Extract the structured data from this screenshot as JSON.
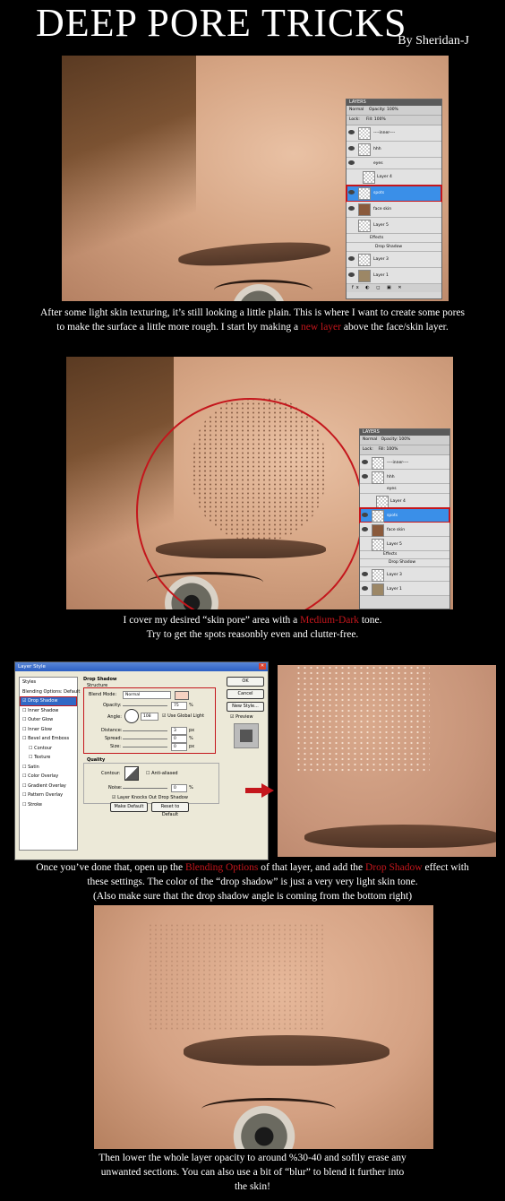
{
  "title": "DEEP PORE TRICKS",
  "byline": "By Sheridan-J",
  "layers_panel": {
    "header": "LAYERS",
    "blend_mode": "Normal",
    "opacity_label": "Opacity:",
    "opacity_value": "100%",
    "lock_label": "Lock:",
    "fill_label": "Fill:",
    "fill_value": "100%",
    "layers": [
      "----inner----",
      "hhh",
      "eyes",
      "Layer 4",
      "spots",
      "face skin",
      "Layer 5",
      "Effects",
      "Drop Shadow",
      "Layer 3",
      "Layer 1"
    ],
    "selected": "spots"
  },
  "step1": {
    "caption_a": "After some light skin texturing, it’s still looking a little plain. This is where I want to create some pores",
    "caption_b_pre": "to make the surface a little more rough. I start by making a ",
    "caption_b_red": "new layer",
    "caption_b_post": " above the face/skin layer."
  },
  "step2": {
    "caption_a_pre": "I cover my desired “skin pore” area with a ",
    "caption_a_red": "Medium-Dark",
    "caption_a_post": " tone.",
    "caption_b": "Try to get the spots reasonbly even and clutter-free."
  },
  "dialog": {
    "title": "Layer Style",
    "styles": [
      "Styles",
      "Blending Options: Default",
      "Drop Shadow",
      "Inner Shadow",
      "Outer Glow",
      "Inner Glow",
      "Bevel and Emboss",
      "Contour",
      "Texture",
      "Satin",
      "Color Overlay",
      "Gradient Overlay",
      "Pattern Overlay",
      "Stroke"
    ],
    "section": "Drop Shadow",
    "structure": "Structure",
    "blend_mode_label": "Blend Mode:",
    "blend_mode": "Normal",
    "opacity_label": "Opacity:",
    "opacity": "75",
    "angle_label": "Angle:",
    "angle": "108",
    "global_light": "Use Global Light",
    "distance_label": "Distance:",
    "distance": "3",
    "spread_label": "Spread:",
    "spread": "0",
    "size_label": "Size:",
    "size": "0",
    "px": "px",
    "pct": "%",
    "quality": "Quality",
    "contour_label": "Contour:",
    "anti_aliased": "Anti-aliased",
    "noise_label": "Noise:",
    "noise": "0",
    "knockout": "Layer Knocks Out Drop Shadow",
    "make_default": "Make Default",
    "reset_default": "Reset to Default",
    "ok": "OK",
    "cancel": "Cancel",
    "new_style": "New Style...",
    "preview": "Preview",
    "swatch_color": "#f6d2c2"
  },
  "step3": {
    "caption_a_pre": "Once you’ve done that, open up the ",
    "caption_a_red1": "Blending Options",
    "caption_a_mid": " of that layer, and add the ",
    "caption_a_red2": "Drop Shadow",
    "caption_a_post": " effect with",
    "caption_b": "these settings. The color of the “drop shadow” is just a very very light skin tone.",
    "caption_c": "(Also make sure that the drop shadow angle is coming from the bottom right)"
  },
  "step4": {
    "caption_a": "Then lower the whole layer opacity to around %30-40 and softly erase any",
    "caption_b": "unwanted sections. You can also use a bit of “blur” to blend it further into",
    "caption_c": "the skin!"
  },
  "colors": {
    "accent_red": "#c4161c",
    "selection_blue": "#3a8fe8"
  }
}
